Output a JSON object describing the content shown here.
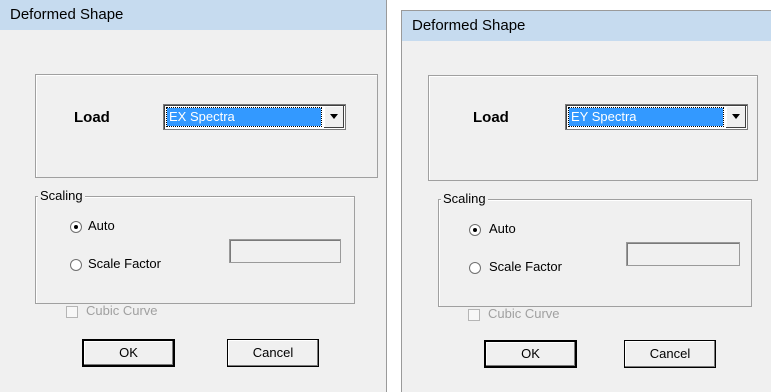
{
  "dialogs": [
    {
      "title": "Deformed Shape",
      "load_label": "Load",
      "load_value": "EX Spectra",
      "scaling_label": "Scaling",
      "auto_label": "Auto",
      "scale_factor_label": "Scale Factor",
      "scale_factor_value": "",
      "cubic_curve_label": "Cubic Curve",
      "ok_label": "OK",
      "cancel_label": "Cancel",
      "selected_option": "Auto"
    },
    {
      "title": "Deformed Shape",
      "load_label": "Load",
      "load_value": "EY Spectra",
      "scaling_label": "Scaling",
      "auto_label": "Auto",
      "scale_factor_label": "Scale Factor",
      "scale_factor_value": "",
      "cubic_curve_label": "Cubic Curve",
      "ok_label": "OK",
      "cancel_label": "Cancel",
      "selected_option": "Auto"
    }
  ],
  "colors": {
    "titlebar": "#c6dbef",
    "dialog_bg": "#f0f0f0",
    "selection": "#3399ff",
    "disabled_text": "#a0a0a0"
  }
}
